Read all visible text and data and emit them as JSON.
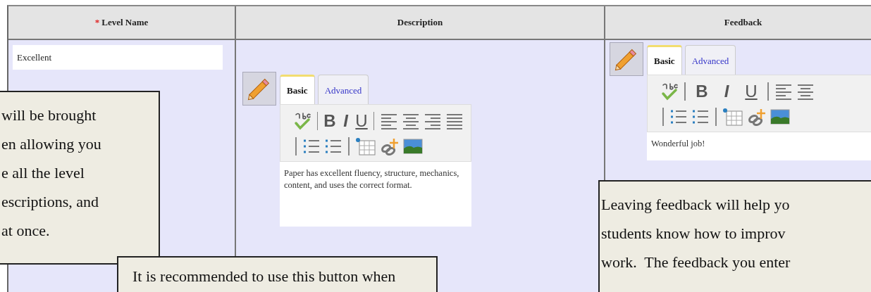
{
  "table": {
    "columns": [
      {
        "label": "Level Name",
        "required_mark": "*"
      },
      {
        "label": "Description"
      },
      {
        "label": "Feedback"
      }
    ],
    "level_name": {
      "value": "Excellent"
    },
    "description": {
      "tabs": [
        {
          "label": "Basic",
          "selected": true
        },
        {
          "label": "Advanced",
          "selected": false
        }
      ],
      "toolbar": [
        {
          "kind": "spellcheck"
        },
        {
          "kind": "separator"
        },
        {
          "kind": "bold",
          "label": "B"
        },
        {
          "kind": "italic",
          "label": "I"
        },
        {
          "kind": "underline",
          "label": "U"
        },
        {
          "kind": "separator"
        },
        {
          "kind": "align-left"
        },
        {
          "kind": "align-center"
        },
        {
          "kind": "align-right"
        },
        {
          "kind": "justify"
        },
        {
          "kind": "break"
        },
        {
          "kind": "separator"
        },
        {
          "kind": "bullet-list"
        },
        {
          "kind": "numbered-list"
        },
        {
          "kind": "separator"
        },
        {
          "kind": "table"
        },
        {
          "kind": "link"
        },
        {
          "kind": "image"
        }
      ],
      "text": "Paper has excellent fluency, structure, mechanics, content, and uses the correct format."
    },
    "feedback": {
      "tabs": [
        {
          "label": "Basic",
          "selected": true
        },
        {
          "label": "Advanced",
          "selected": false
        }
      ],
      "toolbar": [
        {
          "kind": "spellcheck"
        },
        {
          "kind": "separator"
        },
        {
          "kind": "bold",
          "label": "B"
        },
        {
          "kind": "italic",
          "label": "I"
        },
        {
          "kind": "underline",
          "label": "U"
        },
        {
          "kind": "separator"
        },
        {
          "kind": "align-left"
        },
        {
          "kind": "align-center"
        },
        {
          "kind": "break"
        },
        {
          "kind": "separator"
        },
        {
          "kind": "bullet-list"
        },
        {
          "kind": "numbered-list"
        },
        {
          "kind": "separator"
        },
        {
          "kind": "table"
        },
        {
          "kind": "link"
        },
        {
          "kind": "image"
        }
      ],
      "text": "Wonderful job!"
    }
  },
  "callouts": [
    {
      "lines": [
        "will be brought",
        "en allowing you",
        "e all the level",
        "escriptions, and",
        "at once."
      ]
    },
    {
      "lines": [
        "It is recommended to use this button when"
      ]
    },
    {
      "lines": [
        "Leaving feedback will help yo",
        "students know how to improv",
        "work.  The feedback you enter"
      ]
    }
  ]
}
